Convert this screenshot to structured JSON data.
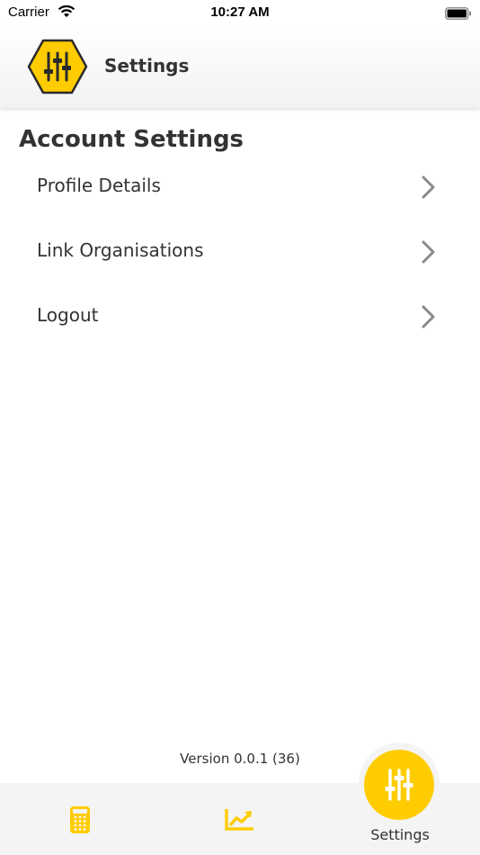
{
  "status_bar": {
    "carrier": "Carrier",
    "time": "10:27 AM"
  },
  "header": {
    "title": "Settings",
    "logo_icon": "sliders-hexagon-icon"
  },
  "account_settings": {
    "heading": "Account Settings",
    "items": [
      {
        "label": "Profile Details",
        "icon": "chevron-right-icon"
      },
      {
        "label": "Link Organisations",
        "icon": "chevron-right-icon"
      },
      {
        "label": "Logout",
        "icon": "chevron-right-icon"
      }
    ]
  },
  "footer": {
    "version": "Version 0.0.1 (36)"
  },
  "tabbar": {
    "tabs": [
      {
        "icon": "calculator-icon",
        "label": ""
      },
      {
        "icon": "trend-chart-icon",
        "label": ""
      },
      {
        "icon": "sliders-icon",
        "label": "Settings",
        "active": true
      }
    ]
  },
  "colors": {
    "accent": "#ffcc00",
    "text": "#333333",
    "chevron": "#8a8a8a",
    "tabbar_bg": "#f4f4f4"
  }
}
